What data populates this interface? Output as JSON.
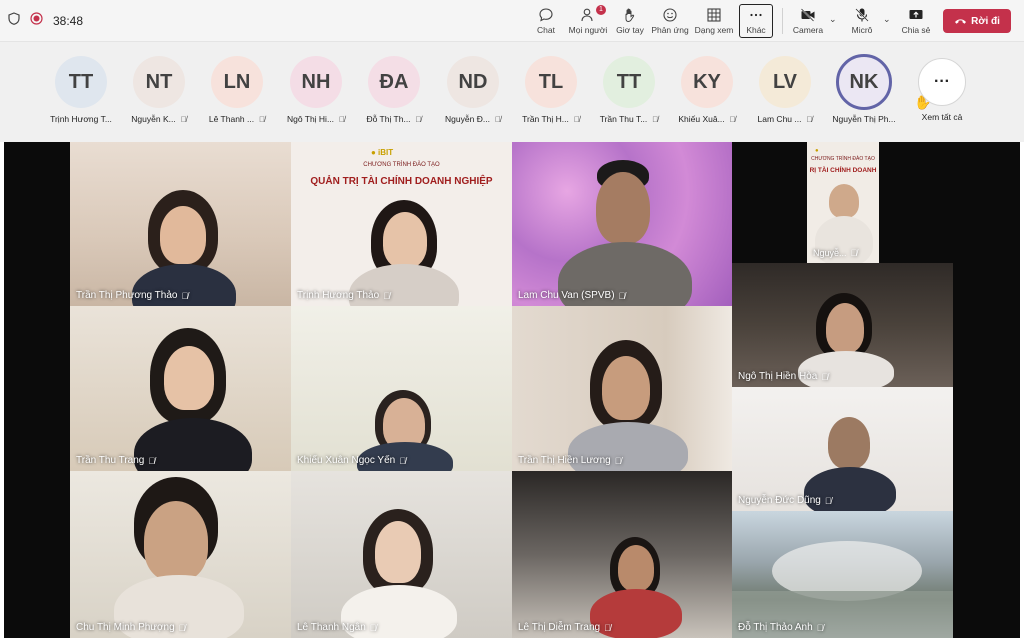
{
  "toolbar": {
    "timer": "38:48",
    "buttons": {
      "chat": "Chat",
      "people": "Mọi người",
      "people_badge": "1",
      "raise": "Giơ tay",
      "react": "Phản ứng",
      "view": "Dạng xem",
      "more": "Khác",
      "camera": "Camera",
      "mic": "Micrô",
      "share": "Chia sẻ",
      "leave": "Rời đi"
    }
  },
  "strip": {
    "participants": [
      {
        "initials": "TT",
        "name": "Trịnh Hương T...",
        "color": "#dfe6ee",
        "muted": false
      },
      {
        "initials": "NT",
        "name": "Nguyễn K...",
        "color": "#eee6e2",
        "muted": true
      },
      {
        "initials": "LN",
        "name": "Lê Thanh ...",
        "color": "#f7e2dc",
        "muted": true
      },
      {
        "initials": "NH",
        "name": "Ngô Thị Hi...",
        "color": "#f4dde6",
        "muted": true
      },
      {
        "initials": "ĐA",
        "name": "Đỗ Thị Th...",
        "color": "#f4dee6",
        "muted": true
      },
      {
        "initials": "ND",
        "name": "Nguyễn Đ...",
        "color": "#eee6e2",
        "muted": true
      },
      {
        "initials": "TL",
        "name": "Trần Thị H...",
        "color": "#f7e2dc",
        "muted": true
      },
      {
        "initials": "TT",
        "name": "Trần Thu T...",
        "color": "#e2efdf",
        "muted": true
      },
      {
        "initials": "KY",
        "name": "Khiếu Xuâ...",
        "color": "#f7e2dc",
        "muted": true
      },
      {
        "initials": "LV",
        "name": "Lam Chu ...",
        "color": "#f4ead8",
        "muted": true
      },
      {
        "initials": "NK",
        "name": "Nguyễn Thị Ph...",
        "color": "#ebe7f3",
        "muted": false,
        "speaking": true
      }
    ],
    "see_all": "Xem tất cả"
  },
  "tiles": [
    {
      "name": "Trần Thị Phương Thảo"
    },
    {
      "name": "Trịnh Hương Thảo",
      "banner_small": "CHƯƠNG TRÌNH ĐÀO TẠO",
      "banner_big": "QUẢN TRỊ TÀI CHÍNH DOANH NGHIỆP"
    },
    {
      "name": "Lam Chu Van (SPVB)"
    },
    {
      "name": "Nguyễ...",
      "banner_small": "CHƯƠNG TRÌNH ĐÀO TẠO",
      "banner_big": "RỊ TÀI CHÍNH DOANH"
    },
    {
      "name": "Trần Thu Trang"
    },
    {
      "name": "Khiếu Xuân Ngọc Yến"
    },
    {
      "name": "Trần Thị Hiền Lương"
    },
    {
      "name": "Ngô Thị Hiền Hòa"
    },
    {
      "name": "Nguyễn Đức Dũng"
    },
    {
      "name": "Chu Thị Minh Phượng"
    },
    {
      "name": "Lê Thanh Ngân"
    },
    {
      "name": "Lê Thị Diễm Trang"
    },
    {
      "name": "Đỗ Thị Thảo Anh"
    }
  ]
}
